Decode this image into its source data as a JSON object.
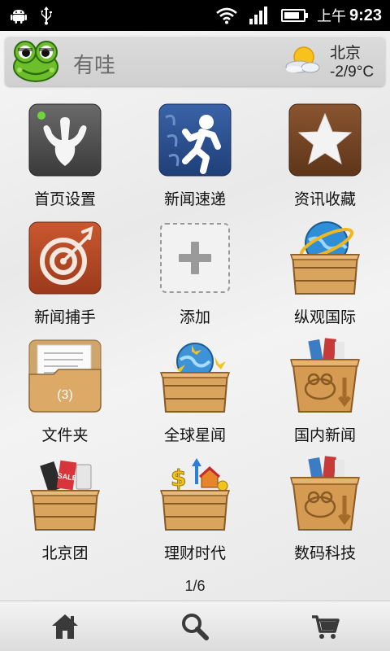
{
  "status_bar": {
    "ampm": "上午",
    "time": "9:23",
    "battery_level": 0.8
  },
  "header": {
    "app_name": "有哇",
    "city": "北京",
    "temperature": "-2/9°C",
    "weather_icon": "sunny-cloudy-icon",
    "avatar_icon": "frog-icon"
  },
  "grid": [
    {
      "label": "首页设置",
      "icon": "frog-foot-icon"
    },
    {
      "label": "新闻速递",
      "icon": "running-man-icon"
    },
    {
      "label": "资讯收藏",
      "icon": "star-icon"
    },
    {
      "label": "新闻捕手",
      "icon": "target-icon"
    },
    {
      "label": "添加",
      "icon": "plus-icon"
    },
    {
      "label": "纵观国际",
      "icon": "globe-box-icon"
    },
    {
      "label": "文件夹",
      "icon": "folder-icon",
      "badge": "(3)"
    },
    {
      "label": "全球星闻",
      "icon": "star-globe-box-icon"
    },
    {
      "label": "国内新闻",
      "icon": "frog-box-icon"
    },
    {
      "label": "北京团",
      "icon": "shopping-box-icon"
    },
    {
      "label": "理财时代",
      "icon": "money-box-icon"
    },
    {
      "label": "数码科技",
      "icon": "frog-box-icon"
    }
  ],
  "pager": {
    "text": "1/6"
  },
  "bottom_nav": [
    {
      "icon": "home-icon"
    },
    {
      "icon": "search-icon"
    },
    {
      "icon": "cart-icon"
    }
  ],
  "colors": {
    "status_bar": "#000000",
    "header_bg": "#d6d6d6",
    "crate": "#d9a45e",
    "frog_green": "#6cbf2a"
  }
}
